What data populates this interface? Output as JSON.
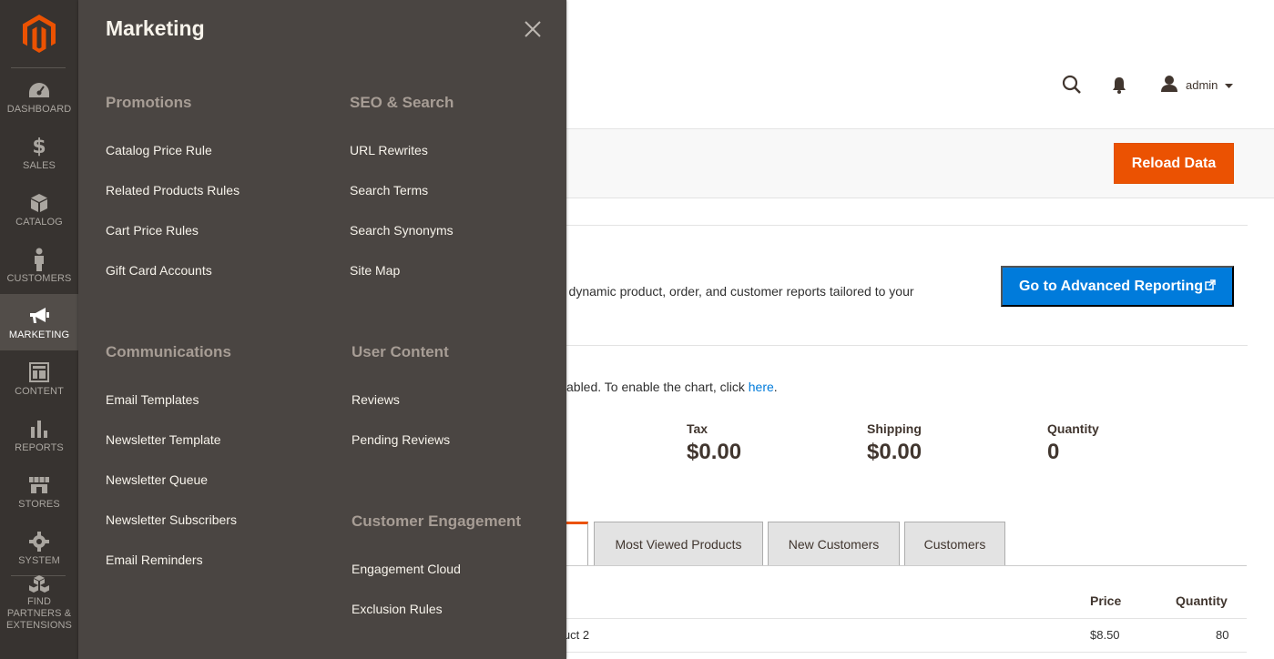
{
  "sidebar": {
    "items": [
      {
        "label": "DASHBOARD",
        "icon": "dashboard-icon"
      },
      {
        "label": "SALES",
        "icon": "dollar-icon"
      },
      {
        "label": "CATALOG",
        "icon": "box-icon"
      },
      {
        "label": "CUSTOMERS",
        "icon": "person-icon"
      },
      {
        "label": "MARKETING",
        "icon": "megaphone-icon"
      },
      {
        "label": "CONTENT",
        "icon": "layout-icon"
      },
      {
        "label": "REPORTS",
        "icon": "bar-chart-icon"
      },
      {
        "label": "STORES",
        "icon": "store-icon"
      },
      {
        "label": "SYSTEM",
        "icon": "gear-icon"
      },
      {
        "label": "FIND PARTNERS & EXTENSIONS",
        "icon": "cubes-icon"
      }
    ],
    "active": "MARKETING",
    "colors": {
      "background": "#373330",
      "active": "#524d49",
      "logo": "#eb5202"
    }
  },
  "flyout": {
    "title": "Marketing",
    "sections": {
      "promotions": {
        "title": "Promotions",
        "items": [
          "Catalog Price Rule",
          "Related Products Rules",
          "Cart Price Rules",
          "Gift Card Accounts"
        ]
      },
      "seo": {
        "title": "SEO & Search",
        "items": [
          "URL Rewrites",
          "Search Terms",
          "Search Synonyms",
          "Site Map"
        ]
      },
      "communications": {
        "title": "Communications",
        "items": [
          "Email Templates",
          "Newsletter Template",
          "Newsletter Queue",
          "Newsletter Subscribers",
          "Email Reminders"
        ]
      },
      "user_content": {
        "title": "User Content",
        "items": [
          "Reviews",
          "Pending Reviews"
        ]
      },
      "engagement": {
        "title": "Customer Engagement",
        "items": [
          "Engagement Cloud",
          "Exclusion Rules"
        ]
      }
    }
  },
  "header": {
    "user": "admin"
  },
  "actions": {
    "reload_label": "Reload Data",
    "accent": "#eb5202"
  },
  "advanced": {
    "text": "r dynamic product, order, and customer reports tailored to your",
    "button_label": "Go to Advanced Reporting",
    "button_color": "#007bdb"
  },
  "chart_notice": {
    "text": "abled. To enable the chart, click ",
    "link": "here",
    "suffix": "."
  },
  "metrics": [
    {
      "label": "Tax",
      "value": "$0.00"
    },
    {
      "label": "Shipping",
      "value": "$0.00"
    },
    {
      "label": "Quantity",
      "value": "0"
    }
  ],
  "tabs": [
    "Most Viewed Products",
    "New Customers",
    "Customers"
  ],
  "table": {
    "columns": {
      "price": "Price",
      "quantity": "Quantity"
    },
    "rows": [
      {
        "name": "luct 2",
        "price": "$8.50",
        "quantity": "80"
      }
    ]
  }
}
